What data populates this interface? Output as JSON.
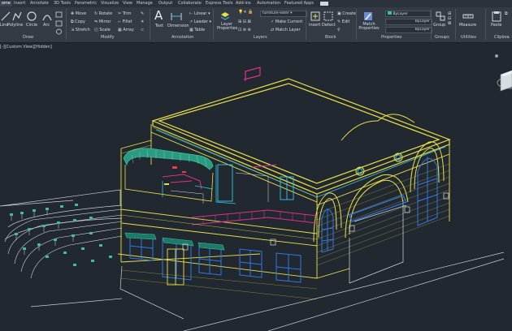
{
  "tabs": [
    "ome",
    "Insert",
    "Annotate",
    "3D Tools",
    "Parametric",
    "Visualize",
    "View",
    "Manage",
    "Output",
    "Collaborate",
    "Express Tools",
    "Add-ins",
    "Automation",
    "Featured Apps"
  ],
  "draw": {
    "line": "Line",
    "polyline": "Polyline",
    "circle": "Circle",
    "arc": "Arc",
    "label": "Draw"
  },
  "modify": {
    "move": "Move",
    "rotate": "Rotate",
    "trim": "Trim",
    "copy": "Copy",
    "mirror": "Mirror",
    "fillet": "Fillet",
    "stretch": "Stretch",
    "scale": "Scale",
    "array": "Array",
    "label": "Modify"
  },
  "annotation": {
    "text": "Text",
    "dimension": "Dimension",
    "linear": "Linear",
    "leader": "Leader",
    "table": "Table",
    "label": "Annotation"
  },
  "layers": {
    "layer_properties": "Layer Properties",
    "current_layer": "furniture-exter",
    "make_current": "Make Current",
    "match_layer": "Match Layer",
    "label": "Layers"
  },
  "block": {
    "insert": "Insert",
    "create": "Create",
    "edit": "Edit",
    "label": "Block"
  },
  "properties": {
    "match": "Match Properties",
    "color": "ByLayer",
    "linetype": "ByLayer",
    "lineweight": "ByLayer",
    "label": "Properties"
  },
  "groups": {
    "group": "Group",
    "label": "Groups"
  },
  "utilities": {
    "measure": "Measure",
    "label": "Utilities"
  },
  "clipboard": {
    "paste": "Paste",
    "label": "Clipboa"
  },
  "viewport": {
    "label": "[-][Custom View][Hidden]"
  },
  "colors": {
    "background": "#212830",
    "ribbon": "#343b45",
    "yellow": "#e9e14a",
    "cyan": "#36c6e6",
    "magenta": "#e0308e",
    "teal": "#3fbf95",
    "white": "#d9dde2",
    "blue": "#2f79e6",
    "red": "#e64040"
  }
}
